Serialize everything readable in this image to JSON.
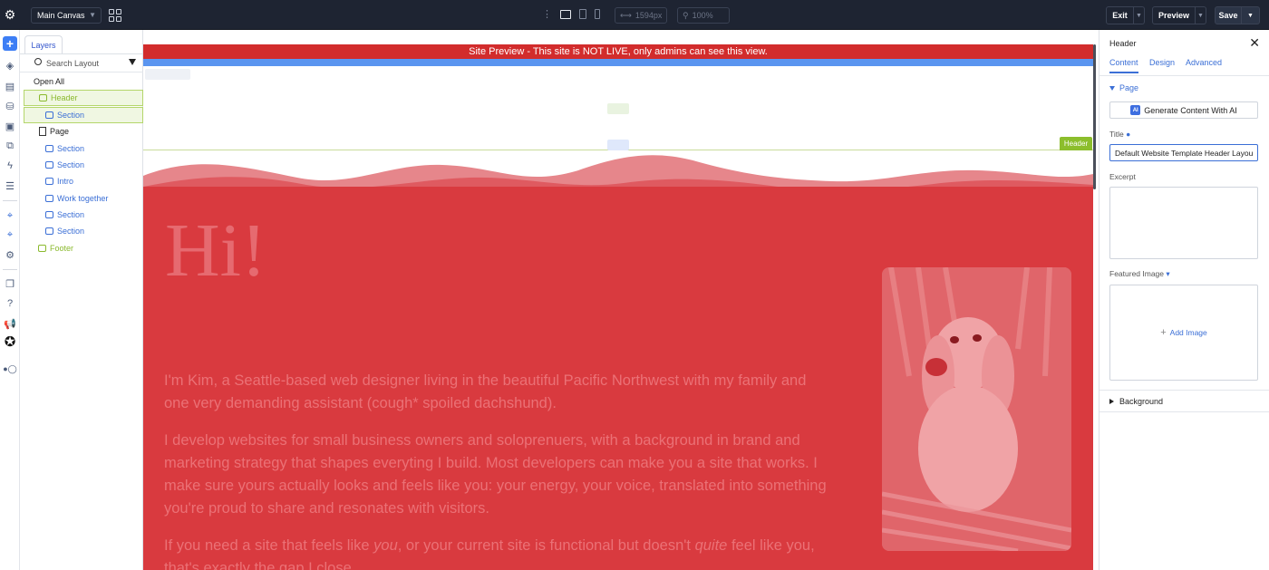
{
  "topbar": {
    "canvas_select": "Main Canvas",
    "width_value": "1594px",
    "zoom_value": "100%",
    "exit_label": "Exit",
    "preview_label": "Preview",
    "save_label": "Save"
  },
  "layers": {
    "tab_label": "Layers",
    "search_placeholder": "Search Layout",
    "open_all": "Open All",
    "items": [
      {
        "label": "Header",
        "kind": "header"
      },
      {
        "label": "Section",
        "kind": "section"
      },
      {
        "label": "Page",
        "kind": "page"
      },
      {
        "label": "Section",
        "kind": "section"
      },
      {
        "label": "Section",
        "kind": "section"
      },
      {
        "label": "Intro",
        "kind": "section"
      },
      {
        "label": "Work together",
        "kind": "section"
      },
      {
        "label": "Section",
        "kind": "section"
      },
      {
        "label": "Section",
        "kind": "section"
      },
      {
        "label": "Footer",
        "kind": "footer"
      }
    ]
  },
  "canvas": {
    "preview_banner": "Site Preview - This site is NOT LIVE, only admins can see this view.",
    "header_badge": "Header",
    "hero_heading": "Hi!",
    "paragraph1": "I'm Kim, a Seattle-based web designer living in the beautiful Pacific Northwest with my family and one very demanding assistant (cough* spoiled dachshund).",
    "paragraph2": "I develop websites for small business owners and soloprenuers, with a background in brand and marketing strategy that shapes everyting I build. Most developers can make you a site that works. I make sure yours actually looks and feels like you: your energy, your voice, translated into something you're proud to share and resonates with visitors.",
    "p3_a": "If you need a site that feels like ",
    "p3_b": "you",
    "p3_c": ", or your current site is functional but doesn't ",
    "p3_d": "quite",
    "p3_e": " feel like you, that's exactly the gap I close."
  },
  "panel": {
    "title": "Header",
    "tabs": [
      "Content",
      "Design",
      "Advanced"
    ],
    "page_section": "Page",
    "ai_badge": "AI",
    "ai_button": "Generate Content With AI",
    "title_label": "Title",
    "title_value": "Default Website Template Header Layout",
    "excerpt_label": "Excerpt",
    "featured_label": "Featured Image",
    "add_image": "Add Image",
    "background_section": "Background"
  },
  "colors": {
    "accent_blue": "#3b6fd6",
    "header_green": "#8cbe2c",
    "hero_red": "#d93a3f",
    "banner_red": "#d22c2c",
    "topbar": "#1e2432"
  }
}
